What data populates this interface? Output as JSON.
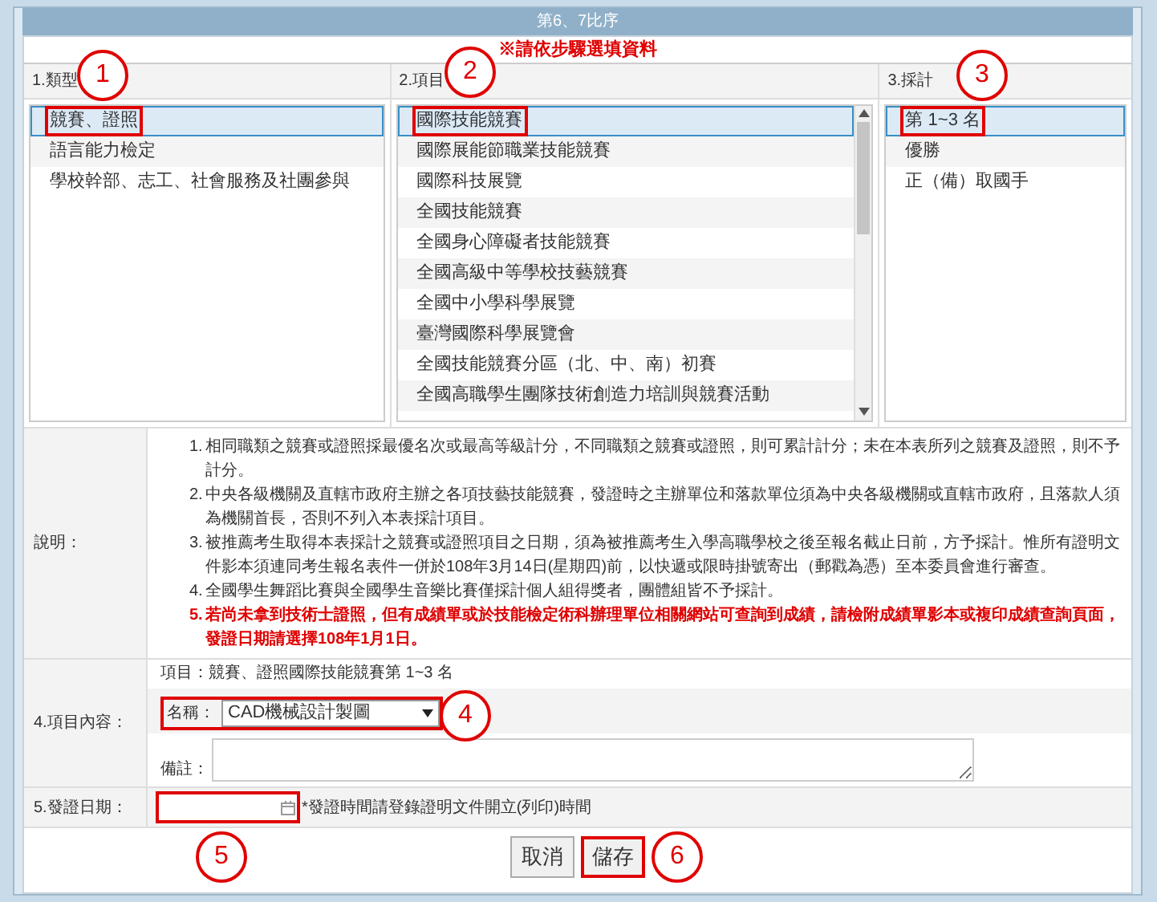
{
  "window": {
    "title": "第6、7比序"
  },
  "instruction": "※請依步驟選填資料",
  "columns": [
    {
      "heading": "1.類型",
      "items": [
        {
          "label": "競賽、證照",
          "selected": true,
          "annotated": true
        },
        {
          "label": "語言能力檢定",
          "selected": false,
          "annotated": false
        },
        {
          "label": "學校幹部、志工、社會服務及社團參與",
          "selected": false,
          "annotated": false
        }
      ]
    },
    {
      "heading": "2.項目",
      "items": [
        {
          "label": "國際技能競賽",
          "selected": true,
          "annotated": true
        },
        {
          "label": "國際展能節職業技能競賽",
          "selected": false,
          "annotated": false
        },
        {
          "label": "國際科技展覽",
          "selected": false,
          "annotated": false
        },
        {
          "label": "全國技能競賽",
          "selected": false,
          "annotated": false
        },
        {
          "label": "全國身心障礙者技能競賽",
          "selected": false,
          "annotated": false
        },
        {
          "label": "全國高級中等學校技藝競賽",
          "selected": false,
          "annotated": false
        },
        {
          "label": "全國中小學科學展覽",
          "selected": false,
          "annotated": false
        },
        {
          "label": "臺灣國際科學展覽會",
          "selected": false,
          "annotated": false
        },
        {
          "label": "全國技能競賽分區（北、中、南）初賽",
          "selected": false,
          "annotated": false
        },
        {
          "label": "全國高職學生團隊技術創造力培訓與競賽活動",
          "selected": false,
          "annotated": false
        }
      ]
    },
    {
      "heading": "3.採計",
      "items": [
        {
          "label": "第 1~3 名",
          "selected": true,
          "annotated": true
        },
        {
          "label": "優勝",
          "selected": false,
          "annotated": false
        },
        {
          "label": "正（備）取國手",
          "selected": false,
          "annotated": false
        }
      ]
    }
  ],
  "notes": {
    "label": "說明：",
    "items": [
      {
        "number": "1.",
        "text": "相同職類之競賽或證照採最優名次或最高等級計分，不同職類之競賽或證照，則可累計計分；未在本表所列之競賽及證照，則不予計分。",
        "emphasis": false
      },
      {
        "number": "2.",
        "text": "中央各級機關及直轄市政府主辦之各項技藝技能競賽，發證時之主辦單位和落款單位須為中央各級機關或直轄市政府，且落款人須為機關首長，否則不列入本表採計項目。",
        "emphasis": false
      },
      {
        "number": "3.",
        "text": "被推薦考生取得本表採計之競賽或證照項目之日期，須為被推薦考生入學高職學校之後至報名截止日前，方予採計。惟所有證明文件影本須連同考生報名表件一併於108年3月14日(星期四)前，以快遞或限時掛號寄出（郵戳為憑）至本委員會進行審查。",
        "emphasis": false
      },
      {
        "number": "4.",
        "text": "全國學生舞蹈比賽與全國學生音樂比賽僅採計個人組得獎者，團體組皆不予採計。",
        "emphasis": false
      },
      {
        "number": "5.",
        "text": "若尚未拿到技術士證照，但有成績單或於技能檢定術科辦理單位相關網站可查詢到成績，請檢附成績單影本或複印成績查詢頁面，發證日期請選擇108年1月1日。",
        "emphasis": true
      }
    ]
  },
  "item_content": {
    "label": "4.項目內容：",
    "summary": "項目：競賽、證照國際技能競賽第 1~3 名",
    "name_label": "名稱：",
    "name_value": "CAD機械設計製圖",
    "name_annotated": true,
    "remark_label": "備註："
  },
  "issue_date": {
    "label": "5.發證日期：",
    "annotated": true,
    "hint": "*發證時間請登錄證明文件開立(列印)時間"
  },
  "buttons": [
    {
      "label": "取消",
      "annotated": false
    },
    {
      "label": "儲存",
      "annotated": true
    }
  ],
  "annotations": [
    {
      "label": "1"
    },
    {
      "label": "2"
    },
    {
      "label": "3"
    },
    {
      "label": "4"
    },
    {
      "label": "5"
    },
    {
      "label": "6"
    }
  ]
}
